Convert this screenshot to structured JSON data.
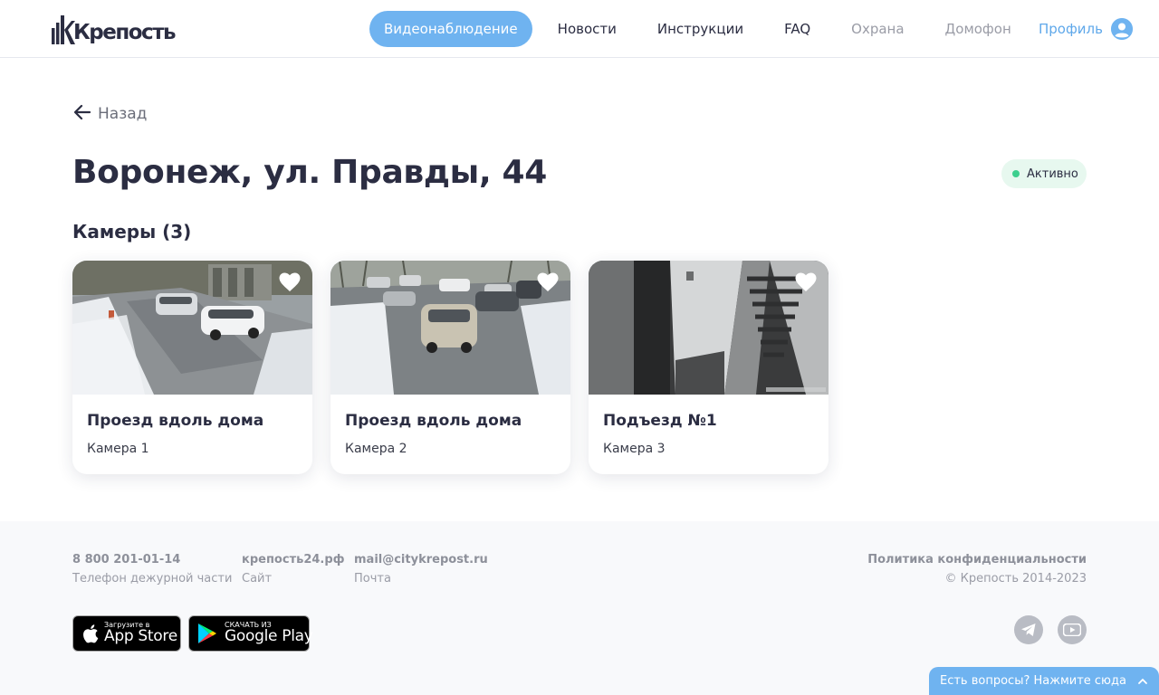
{
  "header": {
    "logo_text": "Крепость",
    "nav": [
      {
        "label": "Видеонаблюдение",
        "state": "active"
      },
      {
        "label": "Новости",
        "state": "normal"
      },
      {
        "label": "Инструкции",
        "state": "normal"
      },
      {
        "label": "FAQ",
        "state": "normal"
      },
      {
        "label": "Охрана",
        "state": "muted"
      },
      {
        "label": "Домофон",
        "state": "muted"
      }
    ],
    "profile_label": "Профиль",
    "profile_icon": "user-avatar-icon"
  },
  "main": {
    "back_label": "Назад",
    "back_icon": "arrow-left-icon",
    "title": "Воронеж, ул. Правды, 44",
    "status": {
      "label": "Активно",
      "color": "#3ccf8e"
    },
    "section_title": "Камеры (3)",
    "cameras": [
      {
        "title": "Проезд вдоль дома",
        "subtitle": "Камера 1",
        "favorite_icon": "heart-icon"
      },
      {
        "title": "Проезд вдоль дома",
        "subtitle": "Камера 2",
        "favorite_icon": "heart-icon"
      },
      {
        "title": "Подъезд №1",
        "subtitle": "Камера 3",
        "favorite_icon": "heart-icon"
      }
    ]
  },
  "footer": {
    "contacts": [
      {
        "main": "8 800 201-01-14",
        "sub": "Телефон дежурной части"
      },
      {
        "main": "крепость24.рф",
        "sub": "Сайт"
      },
      {
        "main": "mail@citykrepost.ru",
        "sub": "Почта"
      }
    ],
    "privacy_link": "Политика конфиденциальности",
    "copyright": "© Крепость 2014-2023",
    "app_store": {
      "small": "Загрузите в",
      "big": "App Store"
    },
    "google_play": {
      "small": "СКАЧАТЬ ИЗ",
      "big": "Google Play"
    },
    "social_icons": [
      "telegram-icon",
      "youtube-icon"
    ]
  },
  "chat": {
    "label": "Есть вопросы? Нажмите сюда"
  },
  "colors": {
    "accent": "#6fb3f0",
    "text": "#2b2d42",
    "muted": "#9a9ca6",
    "status": "#3ccf8e"
  }
}
